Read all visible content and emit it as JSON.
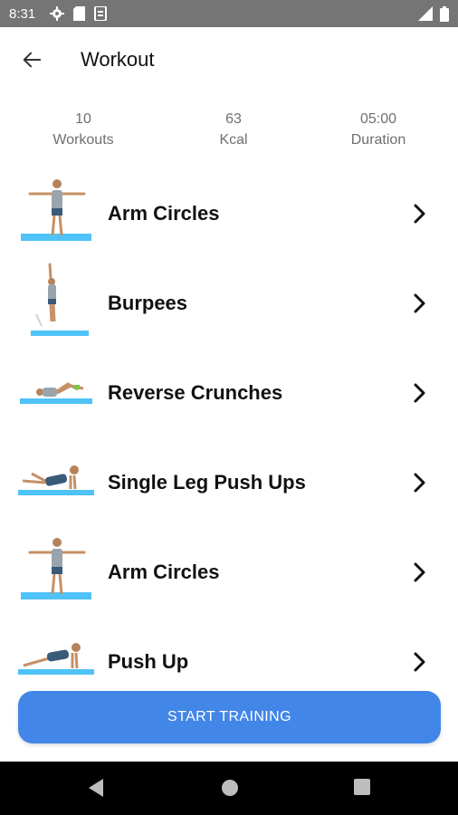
{
  "status_bar": {
    "time": "8:31",
    "icons": [
      "settings-cog-icon",
      "sd-card-icon",
      "sync-icon"
    ],
    "right_icons": [
      "signal-icon",
      "battery-icon"
    ]
  },
  "header": {
    "title": "Workout",
    "back_icon": "arrow-back-icon"
  },
  "stats": [
    {
      "value": "10",
      "label": "Workouts"
    },
    {
      "value": "63",
      "label": "Kcal"
    },
    {
      "value": "05:00",
      "label": "Duration"
    }
  ],
  "exercises": [
    {
      "name": "Arm Circles",
      "pose": "standing-arms-out"
    },
    {
      "name": "Burpees",
      "pose": "jumping"
    },
    {
      "name": "Reverse Crunches",
      "pose": "lying-crunch"
    },
    {
      "name": "Single Leg Push Ups",
      "pose": "push-up"
    },
    {
      "name": "Arm Circles",
      "pose": "standing-arms-out"
    },
    {
      "name": "Push Up",
      "pose": "push-up"
    }
  ],
  "start_button": {
    "label": "START TRAINING"
  },
  "nav": {
    "icons": [
      "back-triangle-icon",
      "home-circle-icon",
      "recents-square-icon"
    ]
  },
  "colors": {
    "accent": "#4286e8",
    "mat": "#4fc3f7",
    "status_bar": "#757575"
  }
}
